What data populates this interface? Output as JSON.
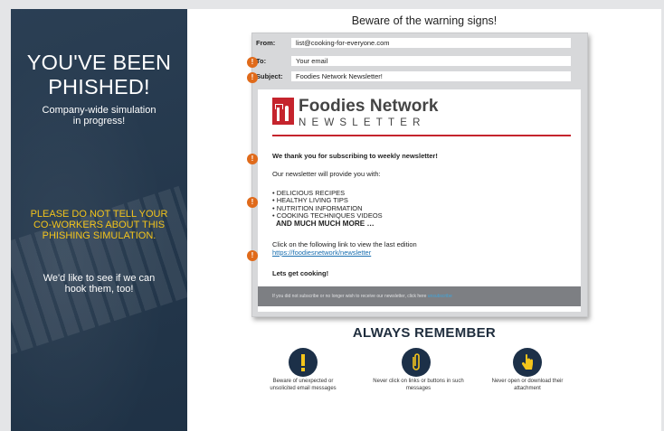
{
  "sidebar": {
    "title": "YOU'VE BEEN PHISHED!",
    "subtitle_line1": "Company-wide simulation",
    "subtitle_line2": "in progress!",
    "warning_line1": "PLEASE DO NOT TELL YOUR",
    "warning_line2": "CO-WORKERS ABOUT THIS",
    "warning_line3": "PHISHING SIMULATION.",
    "hook_line1": "We'd like to see if we can",
    "hook_line2": "hook them, too!"
  },
  "main": {
    "heading": "Beware of the warning signs!",
    "email": {
      "from_label": "From:",
      "from_value": "list@cooking-for-everyone.com",
      "to_label": "To:",
      "to_value": "Your email",
      "subject_label": "Subject:",
      "subject_value": "Foodies Network Newsletter!",
      "brand_name": "Foodies Network",
      "brand_sub": "NEWSLETTER",
      "thanks": "We thank you for subscribing to weekly newsletter!",
      "provide": "Our newsletter will provide you with:",
      "items": [
        "• DELICIOUS RECIPES",
        "• HEALTHY LIVING TIPS",
        "• NUTRITION INFORMATION",
        "• COOKING TECHNIQUES VIDEOS"
      ],
      "more": "AND MUCH MUCH MORE …",
      "click_text": "Click on the following link to view the last edition",
      "link": "https://foodiesnetwork/newsletter",
      "cta": "Lets get cooking!",
      "footer": "If you did not subscribe or no longer wish to receive our newsletter, click here",
      "footer_link": "unsubscribe",
      "warning_mark": "!"
    },
    "remember": {
      "title": "ALWAYS REMEMBER",
      "tips": [
        {
          "icon": "exclamation-icon",
          "line1": "Beware of unexpected or",
          "line2": "unsolicited email messages"
        },
        {
          "icon": "paperclip-icon",
          "line1": "Never click on links or buttons in such",
          "line2": "messages"
        },
        {
          "icon": "pointer-hand-icon",
          "line1": "Never open or download their",
          "line2": "attachment"
        }
      ]
    }
  },
  "colors": {
    "sidebar_bg": "#22374d",
    "warning_yellow": "#f3c41b",
    "brand_red": "#c5242d",
    "alert_orange": "#e06a1a",
    "link_blue": "#1a6fb0"
  }
}
